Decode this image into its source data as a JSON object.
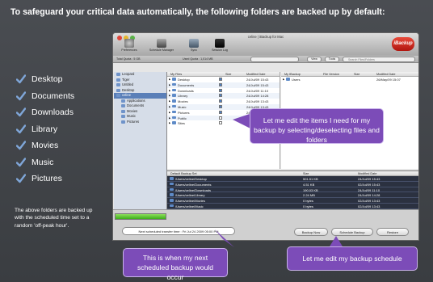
{
  "headline": "To safeguard your critical data automatically, the following folders are backed up by default:",
  "default_folders": [
    "Desktop",
    "Documents",
    "Downloads",
    "Library",
    "Movies",
    "Music",
    "Pictures"
  ],
  "footnote": "The above folders are backed up with the scheduled time set to a random 'off-peak hour'.",
  "window": {
    "title": "celine | iBackup for Mac",
    "brand": "iBackup",
    "toolbar": [
      "Preferences",
      "Schedule Manager",
      "Sync",
      "Session Log"
    ],
    "quota_label": "Total Quota : 5 GB",
    "used_label": "Used Quota : 1,014 MB",
    "search_placeholder": "Search Files/Folders",
    "view_label": "View",
    "tools_label": "Tools"
  },
  "sidebar": {
    "items": [
      "Leopard",
      "Tiger",
      "Untitled",
      "Desktop",
      "celine",
      "Applications",
      "Documents",
      "Movies",
      "Music",
      "Pictures"
    ],
    "selected": "celine"
  },
  "local_pane": {
    "headers": [
      "My Files",
      "Size",
      "Modified Date"
    ],
    "rows": [
      {
        "name": "Desktop",
        "date": "24/Jul/09 15:43",
        "checked": true
      },
      {
        "name": "Documents",
        "date": "24/Jul/09 15:43",
        "checked": true
      },
      {
        "name": "Downloads",
        "date": "24/Jul/09 11:10",
        "checked": true
      },
      {
        "name": "Library",
        "date": "24/Jul/09 14:28",
        "checked": true
      },
      {
        "name": "Movies",
        "date": "24/Jul/09 13:43",
        "checked": true
      },
      {
        "name": "Music",
        "date": "24/Jul/09 13:43",
        "checked": true
      },
      {
        "name": "Pictures",
        "date": "24/Jul/09 15:43",
        "checked": true
      },
      {
        "name": "Public",
        "date": "24/Jul/09 13:32",
        "checked": false
      },
      {
        "name": "Sites",
        "date": "24/Jul/09 13:32",
        "checked": false
      }
    ]
  },
  "remote_pane": {
    "headers": [
      "My IBackup",
      "File Version",
      "Size",
      "Modified Date"
    ],
    "rows": [
      {
        "name": "Users",
        "date": "26/May/09 15:07"
      }
    ]
  },
  "backup_set": {
    "headers": [
      "Default Backup Set",
      "Size",
      "Modified Date"
    ],
    "rows": [
      {
        "path": "/Users/celine/Desktop",
        "size": "501.51 KB",
        "date": "24/Jul/09 15:43"
      },
      {
        "path": "/Users/celine/Documents",
        "size": "4.51 KB",
        "date": "02/Jul/09 15:43"
      },
      {
        "path": "/Users/celine/Downloads",
        "size": "190.03 KB",
        "date": "24/Jul/09 11:10"
      },
      {
        "path": "/Users/celine/Library",
        "size": "2.24 MB",
        "date": "24/Jul/09 14:28"
      },
      {
        "path": "/Users/celine/Movies",
        "size": "0 bytes",
        "date": "02/Jul/09 13:43"
      },
      {
        "path": "/Users/celine/Music",
        "size": "0 bytes",
        "date": "02/Jul/09 13:43"
      },
      {
        "path": "/Users/celine/Pictures",
        "size": "0 bytes",
        "date": "02/Jul/09 13:43"
      }
    ]
  },
  "footer": {
    "next_schedule": "Next scheduled transfer time : Fri Jul 24 2009 05:00 PM",
    "buttons": [
      "Backup Now",
      "Schedule Backup",
      "Restore"
    ]
  },
  "callouts": {
    "edit_items": "Let me edit the items I need for my backup by selecting/deselecting files and folders",
    "next_schedule": "This is when my next scheduled backup would occur",
    "edit_schedule": "Let me edit my backup schedule"
  },
  "colors": {
    "callout": "#7c4cb8",
    "brand": "#c6231a",
    "background": "#3f4246"
  }
}
